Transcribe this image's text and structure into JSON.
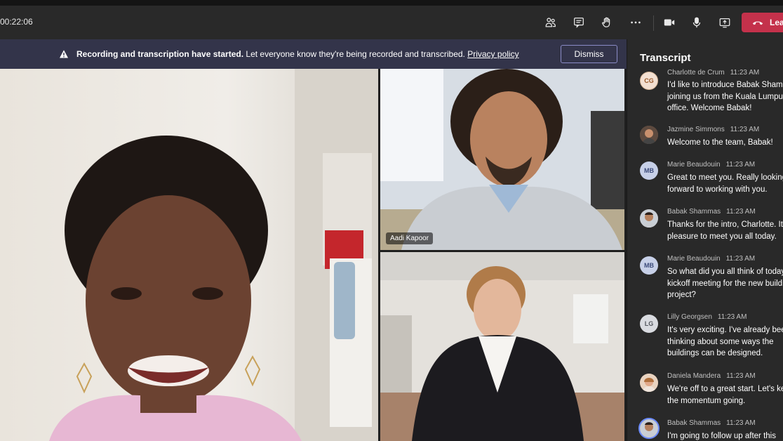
{
  "window": {
    "title": ""
  },
  "toolbar": {
    "timer": "00:22:06",
    "leave_label": "Lea",
    "icons": [
      "people-icon",
      "chat-icon",
      "raise-hand-icon",
      "more-icon",
      "camera-icon",
      "microphone-icon",
      "share-icon"
    ]
  },
  "banner": {
    "bold_text": "Recording and transcription have started.",
    "text": " Let everyone know they're being recorded and transcribed. ",
    "link": "Privacy policy",
    "dismiss_label": "Dismiss"
  },
  "video": {
    "tiles": [
      {
        "name": ""
      },
      {
        "name": "Aadi Kapoor"
      },
      {
        "name": ""
      }
    ]
  },
  "transcript": {
    "title": "Transcript",
    "entries": [
      {
        "initials": "CG",
        "name": "Charlotte de Crum",
        "time": "11:23 AM",
        "text": "I'd like to introduce Babak Shammas joining us from the Kuala Lumpur office. Welcome Babak!"
      },
      {
        "initials": "",
        "name": "Jazmine Simmons",
        "time": "11:23 AM",
        "text": "Welcome to the team, Babak!"
      },
      {
        "initials": "MB",
        "name": "Marie Beaudouin",
        "time": "11:23 AM",
        "text": "Great to meet you. Really looking forward to working with you."
      },
      {
        "initials": "",
        "name": "Babak Shammas",
        "time": "11:23 AM",
        "text": "Thanks for the intro, Charlotte. It's a pleasure to meet you all today."
      },
      {
        "initials": "MB",
        "name": "Marie Beaudouin",
        "time": "11:23 AM",
        "text": "So what did you all think of today's kickoff meeting for the new building project?"
      },
      {
        "initials": "LG",
        "name": "Lilly Georgsen",
        "time": "11:23 AM",
        "text": "It's very exciting. I've already been thinking about some ways the buildings can be designed."
      },
      {
        "initials": "",
        "name": "Daniela Mandera",
        "time": "11:23 AM",
        "text": "We're off to a great start. Let's keep the momentum going."
      },
      {
        "initials": "",
        "name": "Babak Shammas",
        "time": "11:23 AM",
        "text": "I'm going to follow up after this"
      }
    ]
  }
}
